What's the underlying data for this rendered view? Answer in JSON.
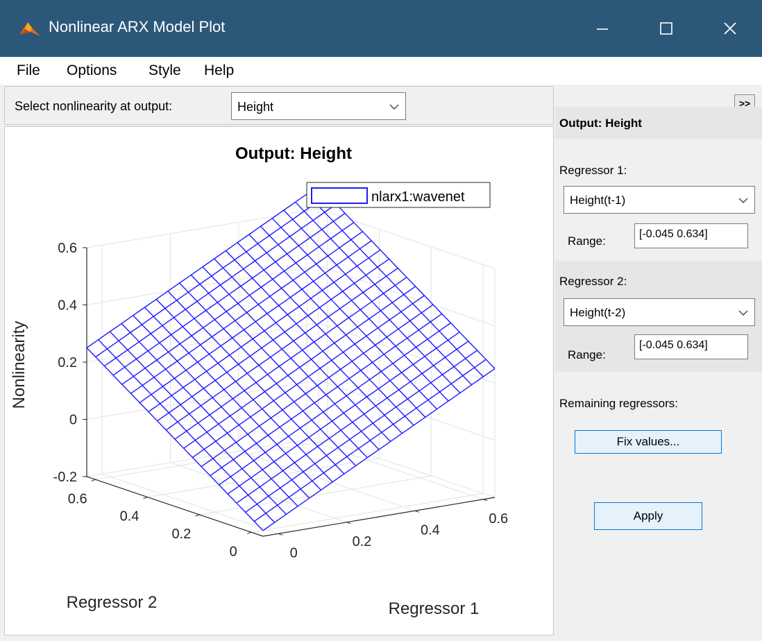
{
  "window": {
    "title": "Nonlinear ARX Model Plot"
  },
  "menu": {
    "items": [
      "File",
      "Options",
      "Style",
      "Help"
    ]
  },
  "selector": {
    "label": "Select nonlinearity at output:",
    "value": "Height"
  },
  "right_panel": {
    "expand_label": ">>",
    "header": "Output: Height",
    "regressor1": {
      "label": "Regressor 1:",
      "value": "Height(t-1)",
      "range_label": "Range:",
      "range_value": "[-0.045 0.634]"
    },
    "regressor2": {
      "label": "Regressor 2:",
      "value": "Height(t-2)",
      "range_label": "Range:",
      "range_value": "[-0.045  0.634]"
    },
    "remaining_label": "Remaining regressors:",
    "fix_values_label": "Fix values...",
    "apply_label": "Apply"
  },
  "colors": {
    "titlebar": "#2b5779",
    "mesh": "#1a1aff"
  },
  "chart_data": {
    "type": "surface",
    "title": "Output: Height",
    "xlabel": "Regressor 1",
    "ylabel": "Regressor 2",
    "zlabel": "Nonlinearity",
    "x_ticks": [
      "0",
      "0.2",
      "0.4",
      "0.6"
    ],
    "y_ticks": [
      "0",
      "0.2",
      "0.4",
      "0.6"
    ],
    "z_ticks": [
      "-0.2",
      "0",
      "0.2",
      "0.4",
      "0.6"
    ],
    "xlim": [
      -0.045,
      0.634
    ],
    "ylim": [
      -0.045,
      0.634
    ],
    "zlim": [
      -0.2,
      0.6
    ],
    "grid": true,
    "grid_size": 20,
    "legend": {
      "label": "nlarx1:wavenet",
      "placement": "top-right"
    },
    "surface_corners": {
      "x_low_y_low": -0.18,
      "x_high_y_low": 0.25,
      "x_low_y_high": 0.25,
      "x_high_y_high": 0.68
    }
  }
}
